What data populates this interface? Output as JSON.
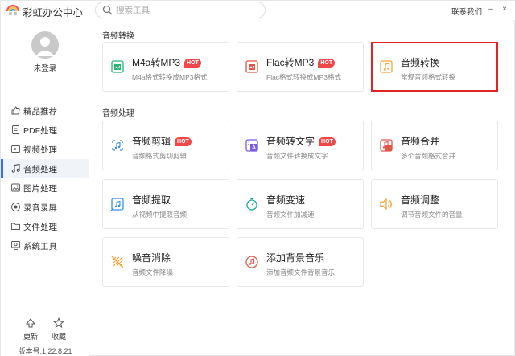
{
  "app": {
    "title": "彩虹办公中心"
  },
  "search": {
    "placeholder": "搜索工具"
  },
  "titlebar": {
    "contact": "联系我们",
    "min": "–",
    "close": "×"
  },
  "user": {
    "login_status": "未登录"
  },
  "sidebar": {
    "items": [
      {
        "label": "精品推荐",
        "icon": "thumbs-up-icon",
        "active": false
      },
      {
        "label": "PDF处理",
        "icon": "pdf-icon",
        "active": false
      },
      {
        "label": "视频处理",
        "icon": "video-icon",
        "active": false
      },
      {
        "label": "音频处理",
        "icon": "music-note-icon",
        "active": true
      },
      {
        "label": "图片处理",
        "icon": "image-icon",
        "active": false
      },
      {
        "label": "录音录屏",
        "icon": "record-icon",
        "active": false
      },
      {
        "label": "文件处理",
        "icon": "folder-icon",
        "active": false
      },
      {
        "label": "系统工具",
        "icon": "system-icon",
        "active": false
      }
    ],
    "update_label": "更新",
    "favorite_label": "收藏",
    "version": "版本号:1.22.8.21"
  },
  "sections": {
    "convert": {
      "title": "音频转换",
      "cards": [
        {
          "title": "M4a转MP3",
          "desc": "M4a格式转换成MP3格式",
          "hot": "HOT",
          "icon": "m4a-file-icon"
        },
        {
          "title": "Flac转MP3",
          "desc": "Flac格式转换成MP3格式",
          "hot": "HOT",
          "icon": "flac-file-icon"
        },
        {
          "title": "音频转换",
          "desc": "常规音频格式转换",
          "icon": "audio-convert-icon",
          "selected": true
        }
      ]
    },
    "process": {
      "title": "音频处理",
      "cards": [
        {
          "title": "音频剪辑",
          "desc": "音频格式剪切剪辑",
          "hot": "HOT",
          "icon": "audio-cut-icon"
        },
        {
          "title": "音频转文字",
          "desc": "音频文件转换成文字",
          "hot": "HOT",
          "icon": "audio-to-text-icon"
        },
        {
          "title": "音频合并",
          "desc": "多个音频格式合并",
          "icon": "audio-merge-icon"
        },
        {
          "title": "音频提取",
          "desc": "从视频中提取音频",
          "icon": "audio-extract-icon"
        },
        {
          "title": "音频变速",
          "desc": "音频文件加减速",
          "icon": "audio-speed-icon"
        },
        {
          "title": "音频调整",
          "desc": "调节音频文件的音量",
          "icon": "audio-adjust-icon"
        },
        {
          "title": "噪音消除",
          "desc": "音频文件降噪",
          "icon": "noise-remove-icon"
        },
        {
          "title": "添加背景音乐",
          "desc": "添加音频文件背景音乐",
          "icon": "add-bgm-icon"
        }
      ]
    }
  },
  "colors": {
    "accent": "#3b6de5",
    "hot": "#f04848",
    "selected_border": "#e02424",
    "green": "#27b573",
    "orange": "#f3a33a",
    "red": "#e2564a",
    "purple": "#7a5ce0",
    "blue": "#3a8ee8",
    "teal": "#1aa89a"
  }
}
